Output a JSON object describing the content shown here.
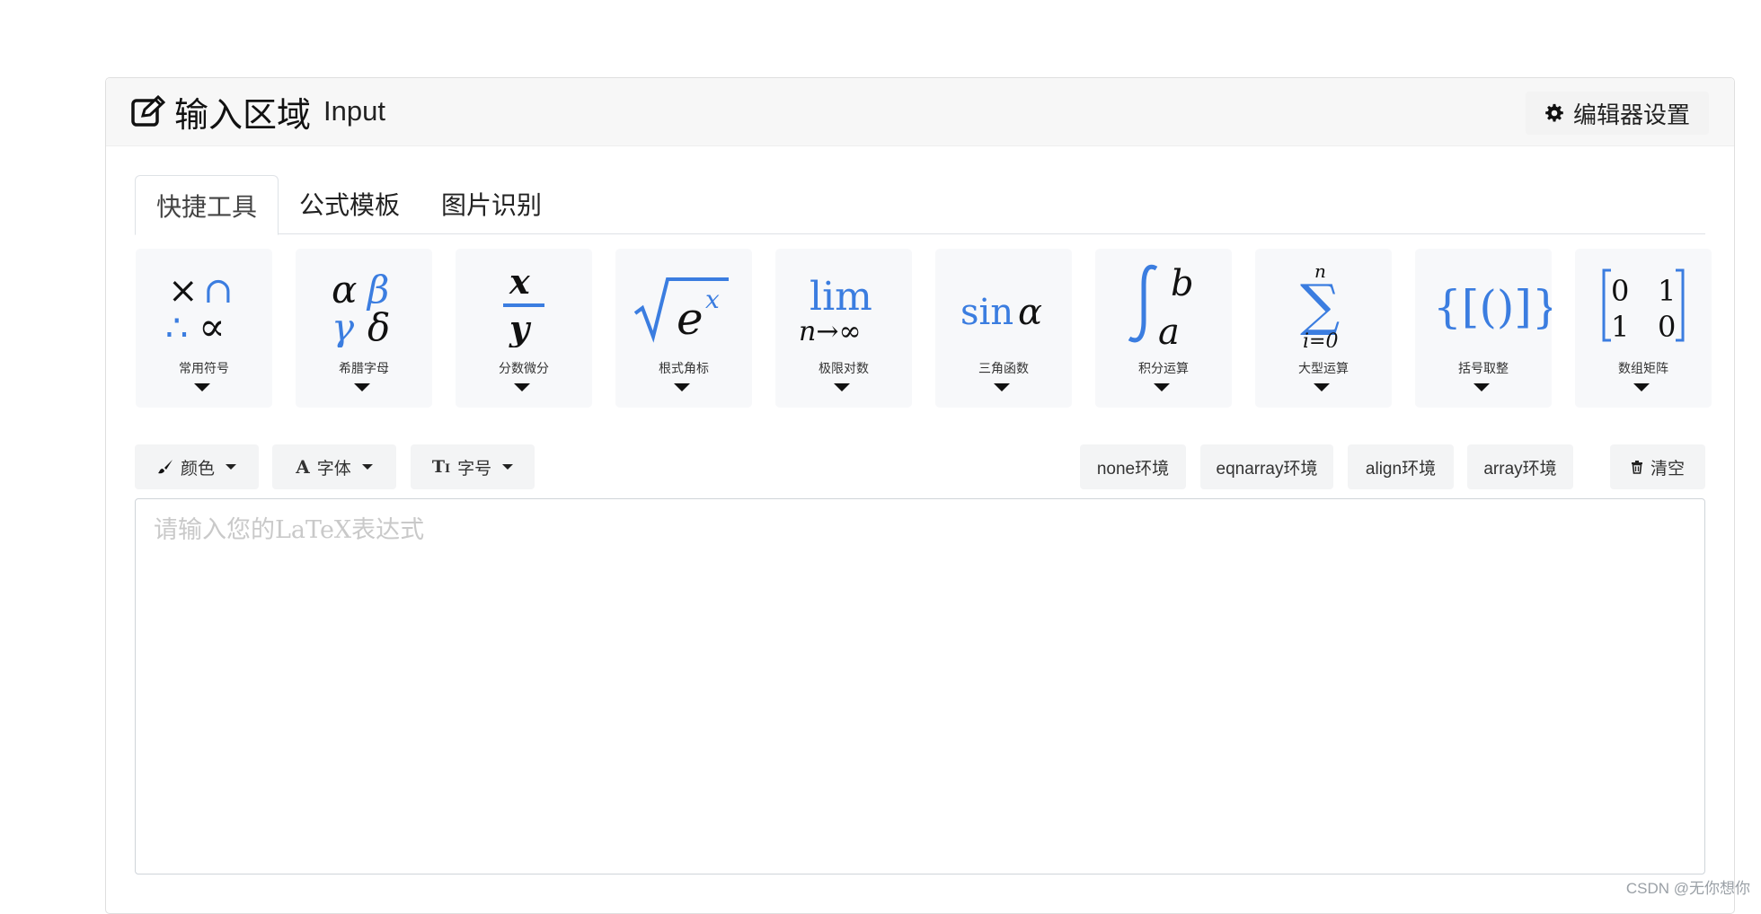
{
  "header": {
    "title_cn": "输入区域",
    "title_en": "Input",
    "title_icon": "edit-icon",
    "settings_label": "编辑器设置",
    "settings_icon": "gear-icon"
  },
  "tabs": [
    {
      "label": "快捷工具",
      "active": true
    },
    {
      "label": "公式模板",
      "active": false
    },
    {
      "label": "图片识别",
      "active": false
    }
  ],
  "tools": [
    {
      "label": "常用符号",
      "glyph": "× ∩ ∴ ∝"
    },
    {
      "label": "希腊字母",
      "glyph": "α β γ δ"
    },
    {
      "label": "分数微分",
      "glyph": "x/y"
    },
    {
      "label": "根式角标",
      "glyph": "√eˣ"
    },
    {
      "label": "极限对数",
      "glyph": "lim n→∞"
    },
    {
      "label": "三角函数",
      "glyph": "sin α"
    },
    {
      "label": "积分运算",
      "glyph": "∫ a b"
    },
    {
      "label": "大型运算",
      "glyph": "∑ i=0 n"
    },
    {
      "label": "括号取整",
      "glyph": "{[()]}"
    },
    {
      "label": "数组矩阵",
      "glyph": "[0 1; 1 0]"
    }
  ],
  "toolbar": {
    "color_label": "颜色",
    "color_icon": "brush-icon",
    "font_label": "字体",
    "font_icon": "font-icon",
    "size_label": "字号",
    "size_icon": "text-size-icon",
    "env_buttons": [
      "none环境",
      "eqnarray环境",
      "align环境",
      "array环境"
    ],
    "clear_label": "清空",
    "clear_icon": "trash-icon"
  },
  "editor": {
    "value": "",
    "placeholder": "请输入您的LaTeX表达式"
  },
  "watermark": "CSDN @无你想你",
  "colors": {
    "accent": "#3b7de0",
    "header_bg": "#f7f7f7",
    "tool_bg": "#f7f8fa"
  }
}
